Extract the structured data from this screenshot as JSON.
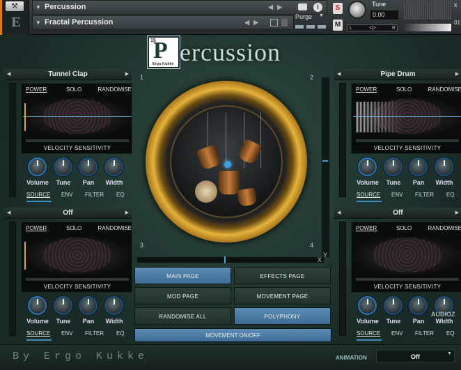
{
  "header": {
    "instrument_name": "Percussion",
    "preset_name": "Fractal Percussion",
    "purge_label": "Purge",
    "solo_label": "S",
    "mute_label": "M",
    "tune_label": "Tune",
    "tune_value": "0.00",
    "pan_left": "L",
    "pan_right": "R",
    "pan_center": "<|>",
    "close_label": "x",
    "output_label": "01"
  },
  "title": {
    "logo_number": "15",
    "logo_letter": "P",
    "logo_name": "Ergo Kukke",
    "rest": "ercussion"
  },
  "panels": [
    {
      "name": "Tunnel Clap",
      "power": "POWER",
      "solo": "SOLO",
      "randomise": "RANDOMISE",
      "velocity": "VELOCITY SENSITIVITY",
      "knobs": [
        "Volume",
        "Tune",
        "Pan",
        "Width"
      ],
      "tabs": [
        "SOURCE",
        "ENV",
        "FILTER",
        "EQ"
      ]
    },
    {
      "name": "Pipe Drum",
      "power": "POWER",
      "solo": "SOLO",
      "randomise": "RANDOMISE",
      "velocity": "VELOCITY SENSITIVITY",
      "knobs": [
        "Volume",
        "Tune",
        "Pan",
        "Width"
      ],
      "tabs": [
        "SOURCE",
        "ENV",
        "FILTER",
        "EQ"
      ]
    },
    {
      "name": "Off",
      "power": "POWER",
      "solo": "SOLO",
      "randomise": "RANDOMISE",
      "velocity": "VELOCITY SENSITIVITY",
      "knobs": [
        "Volume",
        "Tune",
        "Pan",
        "Width"
      ],
      "tabs": [
        "SOURCE",
        "ENV",
        "FILTER",
        "EQ"
      ]
    },
    {
      "name": "Off",
      "power": "POWER",
      "solo": "SOLO",
      "randomise": "RANDOMISE",
      "velocity": "VELOCITY SENSITIVITY",
      "knobs": [
        "Volume",
        "Tune",
        "Pan",
        "Width"
      ],
      "tabs": [
        "SOURCE",
        "ENV",
        "FILTER",
        "EQ"
      ]
    }
  ],
  "corners": [
    "1",
    "2",
    "3",
    "4"
  ],
  "xy": {
    "x": "X",
    "y": "Y"
  },
  "buttons": {
    "main_page": "MAIN PAGE",
    "effects_page": "EFFECTS PAGE",
    "mod_page": "MOD PAGE",
    "movement_page": "MOVEMENT PAGE",
    "randomise_all": "RANDOMISE ALL",
    "polyphony": "POLYPHONY",
    "movement_onoff": "MOVEMENT ON/OFF"
  },
  "footer": {
    "by": "By Ergo Kukke",
    "animation_label": "ANIMATION",
    "animation_value": "Off"
  },
  "watermark": "AUDIOZ",
  "colors": {
    "accent": "#3d6c96",
    "knob_ring": "#2a77b8",
    "waveform": "#6bb4dc",
    "logo_orange": "#e07a18"
  }
}
